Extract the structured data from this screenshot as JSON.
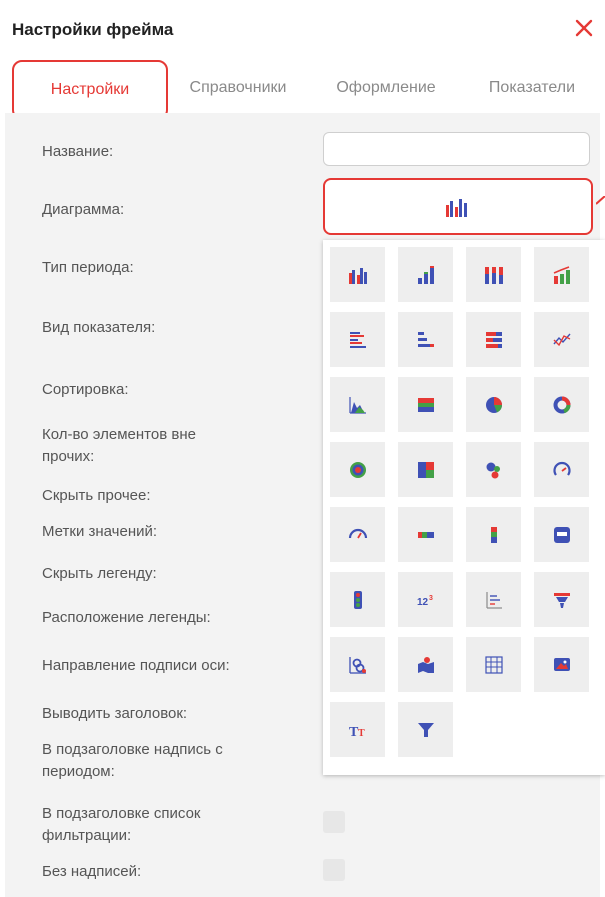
{
  "dialog": {
    "title": "Настройки фрейма"
  },
  "tabs": [
    {
      "label": "Настройки"
    },
    {
      "label": "Справочники"
    },
    {
      "label": "Оформление"
    },
    {
      "label": "Показатели"
    }
  ],
  "form": {
    "name_label": "Название:",
    "name_value": "",
    "chart_label": "Диаграмма:",
    "period_type_label": "Тип периода:",
    "indicator_view_label": "Вид показателя:",
    "sort_label": "Сортировка:",
    "elements_outside_label_line1": "Кол-во элементов вне",
    "elements_outside_label_line2": "прочих:",
    "hide_other_label": "Скрыть прочее:",
    "value_labels_label": "Метки значений:",
    "hide_legend_label": "Скрыть легенду:",
    "legend_position_label": "Расположение легенды:",
    "axis_caption_direction_label": "Направление подписи оси:",
    "show_title_label": "Выводить заголовок:",
    "subtitle_period_label_line1": "В подзаголовке надпись с",
    "subtitle_period_label_line2": "периодом:",
    "subtitle_filter_label_line1": "В подзаголовке список",
    "subtitle_filter_label_line2": "фильтрации:",
    "no_captions_label": "Без надписей:"
  },
  "chart_types": [
    "grouped-column-chart-icon",
    "stacked-column-chart-icon",
    "full-stacked-column-chart-icon",
    "column-line-chart-icon",
    "grouped-bar-chart-icon",
    "stacked-bar-chart-icon",
    "full-stacked-bar-chart-icon",
    "line-chart-icon",
    "area-chart-icon",
    "stacked-area-chart-icon",
    "pie-chart-icon",
    "donut-chart-icon",
    "radial-chart-icon",
    "treemap-chart-icon",
    "bubble-chart-icon",
    "gauge-icon",
    "semi-gauge-icon",
    "horizontal-progress-icon",
    "vertical-progress-icon",
    "indicator-card-icon",
    "traffic-light-icon",
    "number-icon",
    "text-table-icon",
    "list-chart-icon",
    "funnel-chart-icon",
    "graph-icon",
    "map-icon",
    "table-grid-icon",
    "image-icon",
    "text-icon",
    "filter-icon"
  ],
  "colors": {
    "accent": "#e53935",
    "blue": "#3f51b5",
    "panel_bg": "#f3f3f3"
  }
}
